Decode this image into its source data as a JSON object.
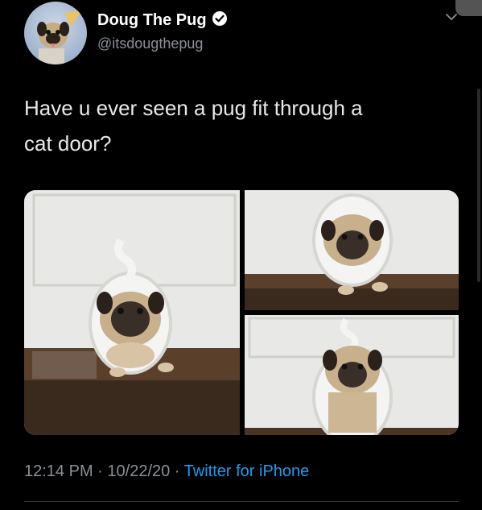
{
  "author": {
    "display_name": "Doug The Pug",
    "handle": "@itsdougthepug",
    "verified_icon": "verified-badge-icon"
  },
  "tweet": {
    "text": "Have u ever seen a pug fit through a\ncat door?"
  },
  "media": {
    "count": 3,
    "photos": [
      "pug-cat-door-photo-1",
      "pug-cat-door-photo-2",
      "pug-cat-door-photo-3"
    ]
  },
  "meta": {
    "time": "12:14 PM",
    "separator": " · ",
    "date": "10/22/20",
    "separator2": " · ",
    "source": "Twitter for iPhone"
  },
  "colors": {
    "background": "#000000",
    "link": "#1d9bf0",
    "muted": "#8a9096"
  }
}
